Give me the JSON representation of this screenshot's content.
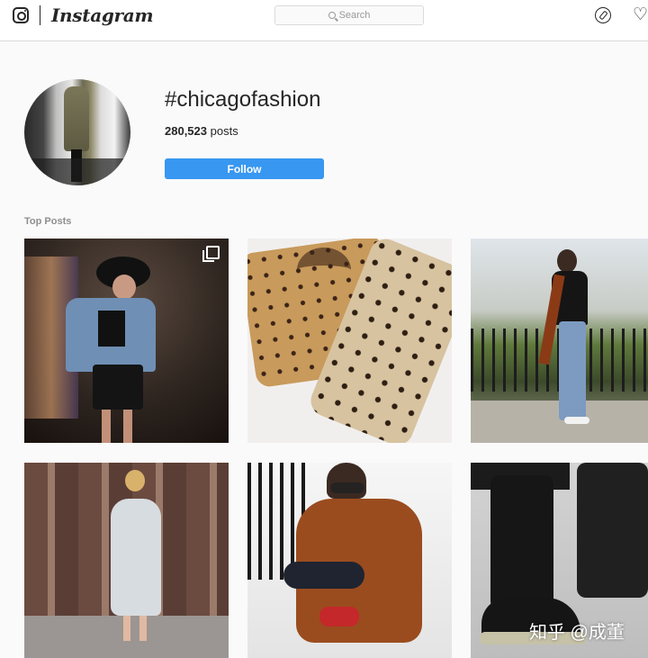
{
  "app": {
    "wordmark": "Instagram"
  },
  "header": {
    "search_placeholder": "Search",
    "icons": [
      "instagram-glyph-icon",
      "search-icon",
      "compass-icon",
      "heart-icon"
    ]
  },
  "profile": {
    "title": "#chicagofashion",
    "post_count": "280,523",
    "post_label": "posts",
    "follow_label": "Follow"
  },
  "top_posts": {
    "label": "Top Posts"
  },
  "watermark": "知乎 @成董",
  "colors": {
    "follow_blue": "#3897f0",
    "border": "#dbdbdb",
    "bg": "#fafafa"
  }
}
